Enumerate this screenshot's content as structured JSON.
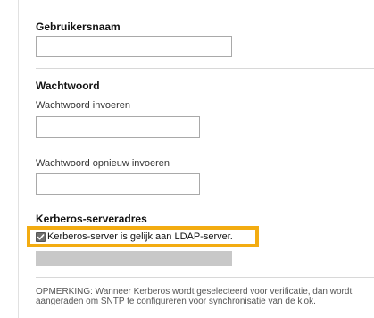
{
  "username": {
    "heading": "Gebruikersnaam",
    "value": ""
  },
  "password": {
    "heading": "Wachtwoord",
    "enter_label": "Wachtwoord invoeren",
    "enter_value": "",
    "reenter_label": "Wachtwoord opnieuw invoeren",
    "reenter_value": ""
  },
  "kerberos": {
    "heading": "Kerberos-serveradres",
    "same_as_ldap_label": "Kerberos-server is gelijk aan LDAP-server.",
    "same_as_ldap_checked": true
  },
  "note": {
    "line1": "OPMERKING: Wanneer Kerberos wordt geselecteerd voor verificatie, dan wordt",
    "line2": "aangeraden om SNTP te configureren voor synchronisatie van de klok."
  },
  "colors": {
    "highlight": "#f3ac11"
  },
  "icons": {
    "checkbox": "checkbox-checked-icon"
  }
}
